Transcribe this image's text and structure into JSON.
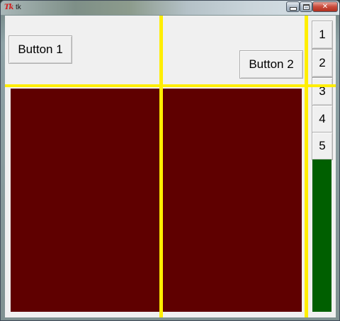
{
  "window": {
    "title": "tk",
    "app_icon": "tk-feather-icon",
    "controls": {
      "minimize_icon": "minimize-icon",
      "maximize_icon": "maximize-icon",
      "close_icon": "close-icon",
      "close_glyph": "✕"
    }
  },
  "buttons": {
    "button1_label": "Button 1",
    "button2_label": "Button 2",
    "numbered": [
      "1",
      "2",
      "3",
      "4",
      "5"
    ]
  },
  "colors": {
    "client_background": "#f0f0f0",
    "red_frame": "#5f0000",
    "green_frame": "#005f00",
    "grid_lines": "#ffee00"
  }
}
